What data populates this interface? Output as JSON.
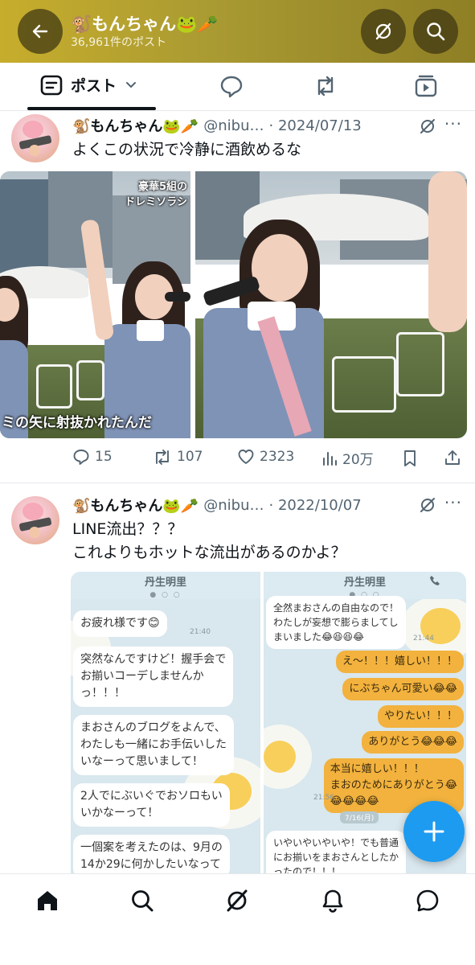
{
  "header": {
    "title": "🐒もんちゃん🐸🥕",
    "subtitle": "36,961件のポスト",
    "icons": [
      "back-arrow-icon",
      "grok-icon",
      "search-icon"
    ]
  },
  "tabs": [
    {
      "label": "ポスト",
      "icon": "post-list-icon",
      "active": true
    },
    {
      "icon": "reply-icon"
    },
    {
      "icon": "repost-icon"
    },
    {
      "icon": "video-icon"
    }
  ],
  "tweets": [
    {
      "name": "🐒もんちゃん🐸🥕",
      "handle": "@nibu…",
      "date": "· 2024/07/13",
      "text": "よくこの状況で冷静に酒飲めるな",
      "media": {
        "left_caption_top": "豪華5組の\nドレミソラシ",
        "left_caption_bottom": "ミの矢に射抜かれたんだ"
      },
      "stats": {
        "replies": "15",
        "reposts": "107",
        "likes": "2323",
        "views": "20万"
      }
    },
    {
      "name": "🐒もんちゃん🐸🥕",
      "handle": "@nibu…",
      "date": "· 2022/10/07",
      "text": "LINE流出？？？\nこれよりもホットな流出があるのかよ？",
      "media": {
        "left_chat": {
          "title": "丹生明里",
          "messages": [
            "お疲れ様です😊",
            "突然なんですけど！握手会で\nお揃いコーデしませんか\nっ！！！",
            "まおさんのブログをよんで、\nわたしも一緒にお手伝いした\nいなーって思いまして！",
            "2人でにぶいぐでおソロもい\nいかなーって！",
            "一個案を考えたのは、9月の\n14か29に何かしたいなって"
          ],
          "time": "21:40"
        },
        "right_chat": {
          "title": "丹生明里",
          "left_messages": [
            "全然まおさんの自由なので！\nわたしが妄想で膨らましてし\nまいました😂😆😆😂",
            "いやいやいやいや！でも普通\nにお揃いをまおさんとしたか\nったので！！！"
          ],
          "right_messages": [
            "え〜！！！嬉しい！！！",
            "にぶちゃん可愛い😂😂",
            "やりたい！！！",
            "ありがとう😂😂😂",
            "本当に嬉しい！！！\nまおのためにありがとう😂\n😂😂😂😂"
          ],
          "times": [
            "21:44",
            "21:56"
          ],
          "date_label": "7/16(月)"
        }
      }
    }
  ],
  "fab": {
    "icon": "plus-icon",
    "label": "+"
  },
  "bottom_nav": [
    "home-icon",
    "search-icon",
    "grok-icon",
    "notifications-icon",
    "messages-icon"
  ],
  "colors": {
    "accent": "#1d9bf0",
    "header_bg": "#b19f31",
    "secondary_text": "#536471"
  }
}
